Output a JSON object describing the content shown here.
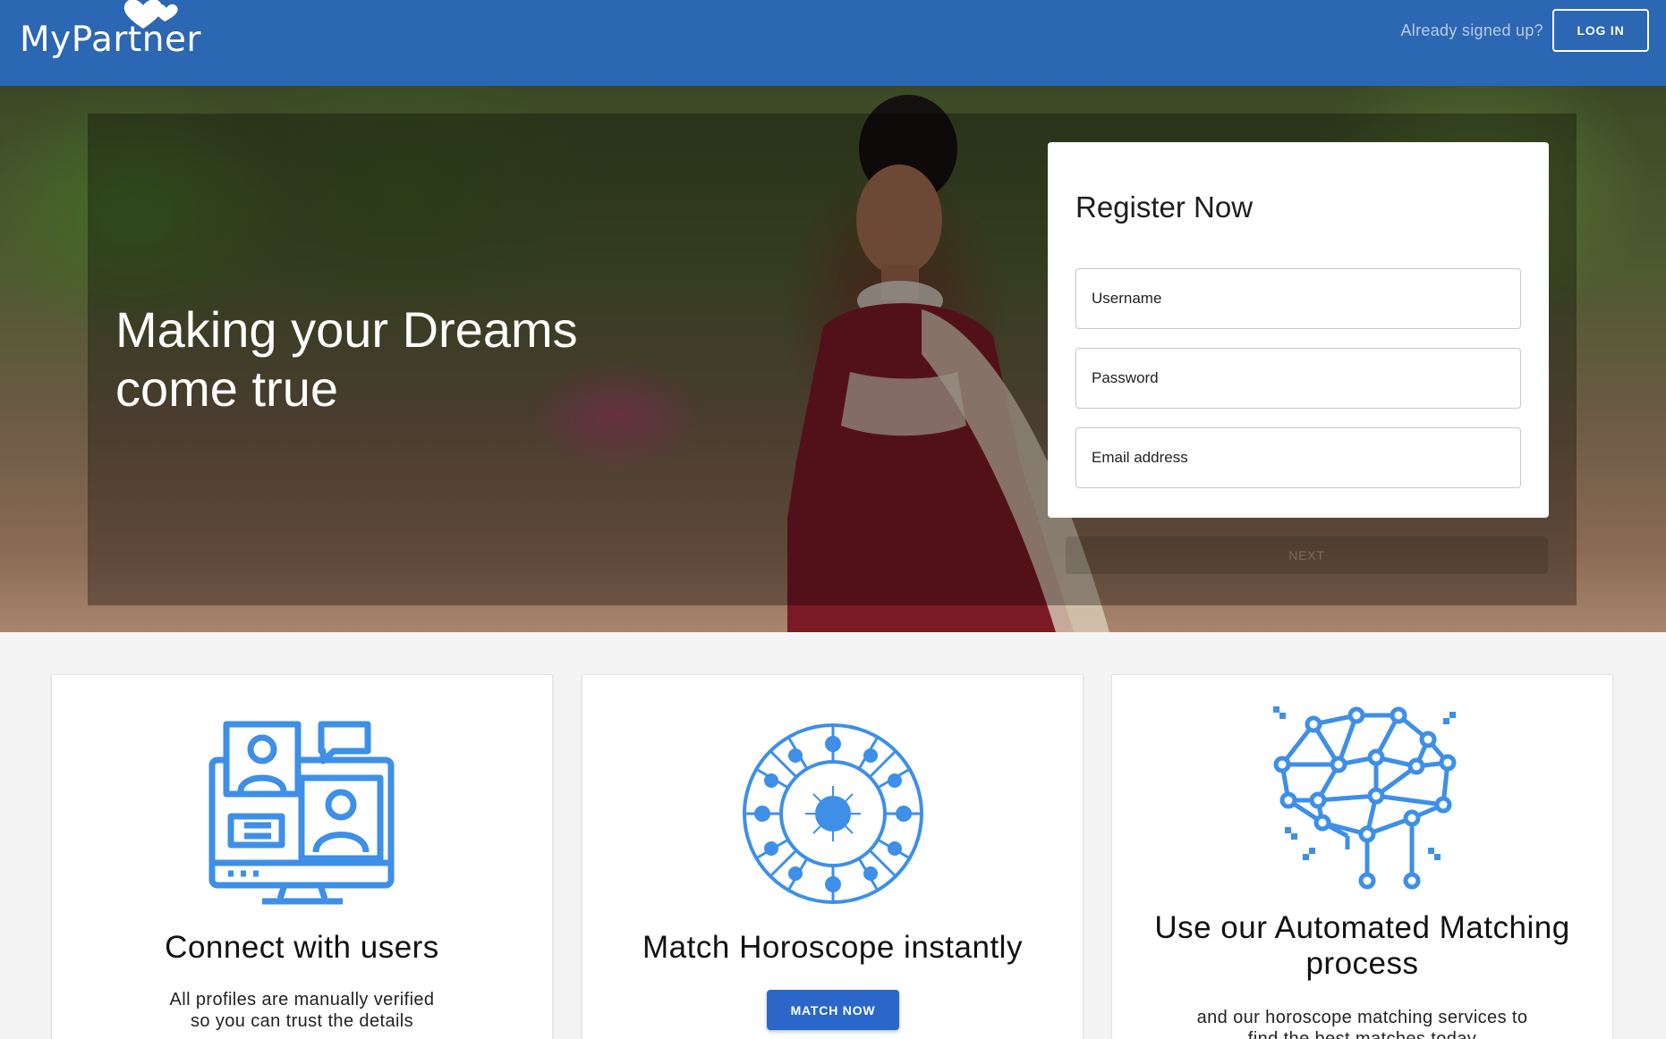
{
  "header": {
    "logo_text": "MyPartner",
    "already_text": "Already signed up?",
    "login_label": "LOG IN"
  },
  "hero": {
    "title_line1": "Making your Dreams",
    "title_line2": "come true"
  },
  "register": {
    "title": "Register Now",
    "username_placeholder": "Username",
    "password_placeholder": "Password",
    "email_placeholder": "Email address",
    "next_label": "NEXT"
  },
  "features": [
    {
      "title": "Connect with users",
      "desc_line1": "All profiles are manually verified",
      "desc_line2": "so you can trust the details",
      "icon": "video-chat-icon"
    },
    {
      "title": "Match Horoscope instantly",
      "button_label": "MATCH NOW",
      "icon": "zodiac-wheel-icon"
    },
    {
      "title_line1": "Use our Automated Matching",
      "title_line2": "process",
      "desc_line1": "and our horoscope matching services to",
      "desc_line2": "find the best matches today",
      "icon": "network-brain-icon"
    }
  ],
  "colors": {
    "header_bg": "#2c67b3",
    "accent_blue": "#2a67c9",
    "icon_blue": "#3d8fe8"
  }
}
